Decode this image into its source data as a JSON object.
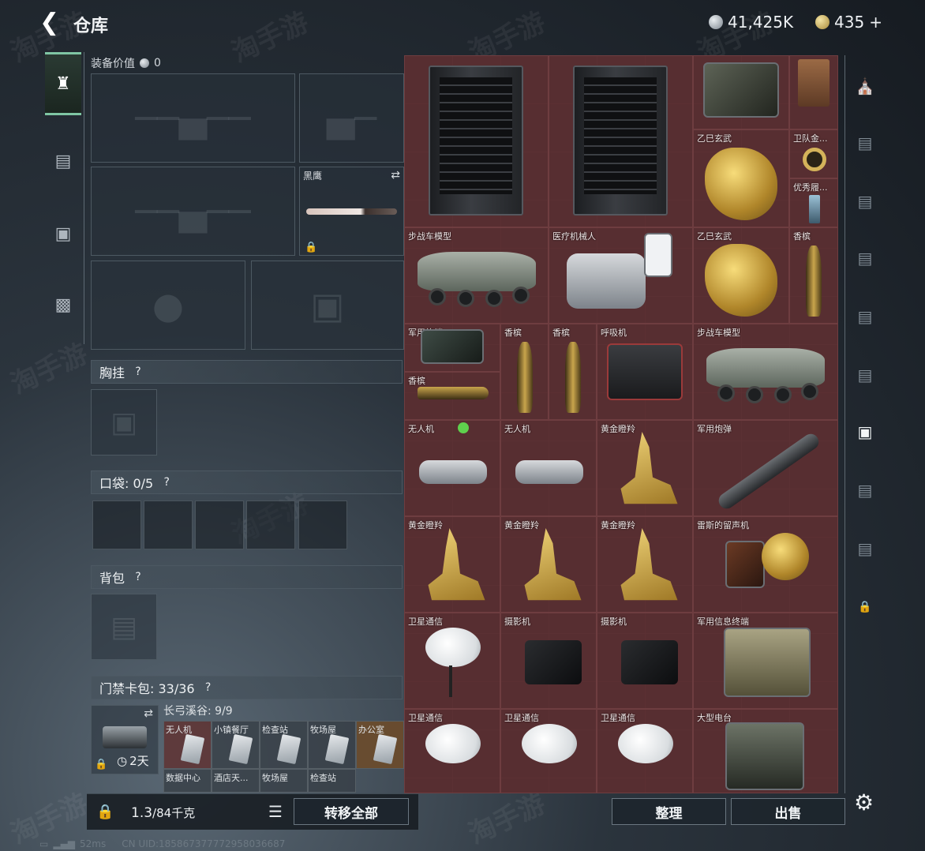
{
  "header": {
    "back_icon": "back-arrow-icon",
    "title": "仓库",
    "currency_silver": "41,425K",
    "currency_gold": "435",
    "currency_gold_add": "+"
  },
  "left_nav": {
    "tabs": [
      {
        "icon": "pistol-icon",
        "active": true
      },
      {
        "icon": "backpack-icon",
        "active": false
      },
      {
        "icon": "clipboard-icon",
        "active": false
      },
      {
        "icon": "toolbox-icon",
        "active": false
      }
    ]
  },
  "equipment": {
    "value_label": "装备价值",
    "value": "0",
    "melee_slot_name": "黑鹰",
    "chest_rig": {
      "label": "胸挂",
      "help": "?"
    },
    "pockets": {
      "label": "口袋: 0/5",
      "help": "?"
    },
    "backpack": {
      "label": "背包",
      "help": "?"
    },
    "keycard": {
      "label": "门禁卡包: 33/36",
      "help": "?",
      "map_label": "长弓溪谷: 9/9",
      "timer": "2天",
      "cards": [
        "无人机",
        "小镇餐厅",
        "检查站",
        "牧场屋",
        "办公室",
        "数据中心",
        "酒店天...",
        "牧场屋",
        "检查站"
      ]
    }
  },
  "footer": {
    "weight": "1.3",
    "weight_max": "/84千克",
    "transfer_all": "转移全部",
    "sort": "整理",
    "sell": "出售"
  },
  "inventory": {
    "items": [
      {
        "name": ""
      },
      {
        "name": ""
      },
      {
        "name": ""
      },
      {
        "name": ""
      },
      {
        "name": "乙巳玄武"
      },
      {
        "name": "卫队金..."
      },
      {
        "name": "优秀履..."
      },
      {
        "name": "步战车模型"
      },
      {
        "name": "医疗机械人"
      },
      {
        "name": "乙巳玄武"
      },
      {
        "name": "香槟"
      },
      {
        "name": "军用终端"
      },
      {
        "name": "香槟"
      },
      {
        "name": "香槟"
      },
      {
        "name": "香槟"
      },
      {
        "name": "呼吸机"
      },
      {
        "name": "步战车模型"
      },
      {
        "name": "无人机"
      },
      {
        "name": "无人机"
      },
      {
        "name": "黄金瞪羚"
      },
      {
        "name": "军用炮弹"
      },
      {
        "name": "黄金瞪羚"
      },
      {
        "name": "黄金瞪羚"
      },
      {
        "name": "黄金瞪羚"
      },
      {
        "name": "雷斯的留声机"
      },
      {
        "name": "卫星通信"
      },
      {
        "name": "摄影机"
      },
      {
        "name": "摄影机"
      },
      {
        "name": "军用信息终端"
      },
      {
        "name": "卫星通信"
      },
      {
        "name": "卫星通信"
      },
      {
        "name": "卫星通信"
      },
      {
        "name": "大型电台"
      }
    ]
  },
  "status_bar": {
    "ping": "52ms",
    "uid": "CN UID:1858673777729580366​87"
  },
  "colors": {
    "inventory_bg": "#4f2a2d",
    "accent_green": "#7fc6a4",
    "new_dot": "#5fd04d"
  }
}
